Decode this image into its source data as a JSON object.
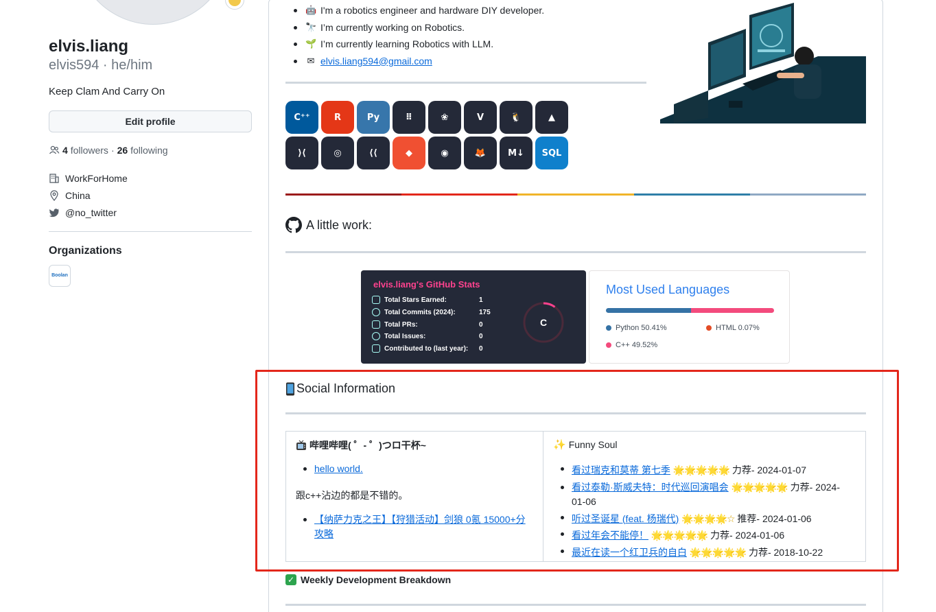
{
  "profile": {
    "full_name": "elvis.liang",
    "username_pronouns": "elvis594 · he/him",
    "bio": "Keep Clam And Carry On",
    "edit_button": "Edit profile",
    "followers_count": "4",
    "followers_label": "followers",
    "dot": "·",
    "following_count": "26",
    "following_label": "following",
    "company": "WorkForHome",
    "location": "China",
    "twitter": "@no_twitter",
    "organizations_title": "Organizations",
    "org_logo_text": "Boolan"
  },
  "readme": {
    "intro": [
      "I'm a robotics engineer and hardware DIY developer.",
      "I’m currently working on Robotics.",
      "I’m currently learning Robotics with LLM.",
      "elvis.liang594@gmail.com"
    ],
    "tech_icons": [
      "c++",
      "rust",
      "python",
      "dots",
      "raspberry-pi",
      "vim",
      "linux",
      "cmake",
      "vscode",
      "blender",
      "flutter",
      "git",
      "github",
      "gitlab",
      "markdown",
      "sqlite"
    ],
    "tech_icon_glyphs": [
      "C⁺⁺",
      "R",
      "Py",
      "⠿",
      "❀",
      "V",
      "🐧",
      "▲",
      "⟩⟨",
      "◎",
      "⟨⟨",
      "◆",
      "◉",
      "🦊",
      "M↓",
      "SQL"
    ],
    "tech_icon_colors": [
      "#00599c",
      "#e43717",
      "#3776ab",
      "#242938",
      "#242938",
      "#242938",
      "#242938",
      "#242938",
      "#242938",
      "#242938",
      "#242938",
      "#f05032",
      "#242938",
      "#242938",
      "#242938",
      "#0f80cc"
    ],
    "colorbar_colors": [
      "#9b1b1b",
      "#e3271b",
      "#f0b429",
      "#2f7fa8",
      "#8fa9c4"
    ],
    "work_heading": "A little work:",
    "stats": {
      "title": "elvis.liang's GitHub Stats",
      "rows": [
        {
          "label": "Total Stars Earned:",
          "value": "1"
        },
        {
          "label": "Total Commits (2024):",
          "value": "175"
        },
        {
          "label": "Total PRs:",
          "value": "0"
        },
        {
          "label": "Total Issues:",
          "value": "0"
        },
        {
          "label": "Contributed to (last year):",
          "value": "0"
        }
      ],
      "grade": "C",
      "grade_progress": 0.1
    },
    "languages": {
      "title": "Most Used Languages",
      "items": [
        {
          "name": "Python 50.41%",
          "percent": 50.41,
          "color": "#3572a5"
        },
        {
          "name": "HTML 0.07%",
          "percent": 0.07,
          "color": "#e34c26"
        },
        {
          "name": "C++ 49.52%",
          "percent": 49.52,
          "color": "#f34b7d"
        }
      ]
    },
    "social_heading": "Social Information",
    "bilibili": {
      "heading": "哔哩哔哩( ゜- ゜)つロ干杯~",
      "link1": "hello world.",
      "text": "跟c++沾边的都是不错的。",
      "link2": "【纳萨力克之王】【狩猎活动】剑狼 0氪 15000+分攻略"
    },
    "funny_soul": {
      "heading": "Funny Soul",
      "items": [
        {
          "link": "看过瑞克和莫蒂 第七季",
          "stars": "🌟🌟🌟🌟🌟",
          "suffix": "力荐- 2024-01-07"
        },
        {
          "link": "看过泰勒·斯威夫特：时代巡回演唱会",
          "stars": "🌟🌟🌟🌟🌟",
          "suffix": "力荐- 2024-01-06"
        },
        {
          "link": "听过圣诞星 (feat. 杨瑞代)",
          "stars": "🌟🌟🌟🌟☆",
          "suffix": "推荐- 2024-01-06"
        },
        {
          "link": "看过年会不能停！",
          "stars": "🌟🌟🌟🌟🌟",
          "suffix": "力荐- 2024-01-06"
        },
        {
          "link": "最近在读一个红卫兵的自白",
          "stars": "🌟🌟🌟🌟🌟",
          "suffix": "力荐- 2018-10-22"
        }
      ]
    },
    "weekly_heading": "Weekly Development Breakdown"
  }
}
